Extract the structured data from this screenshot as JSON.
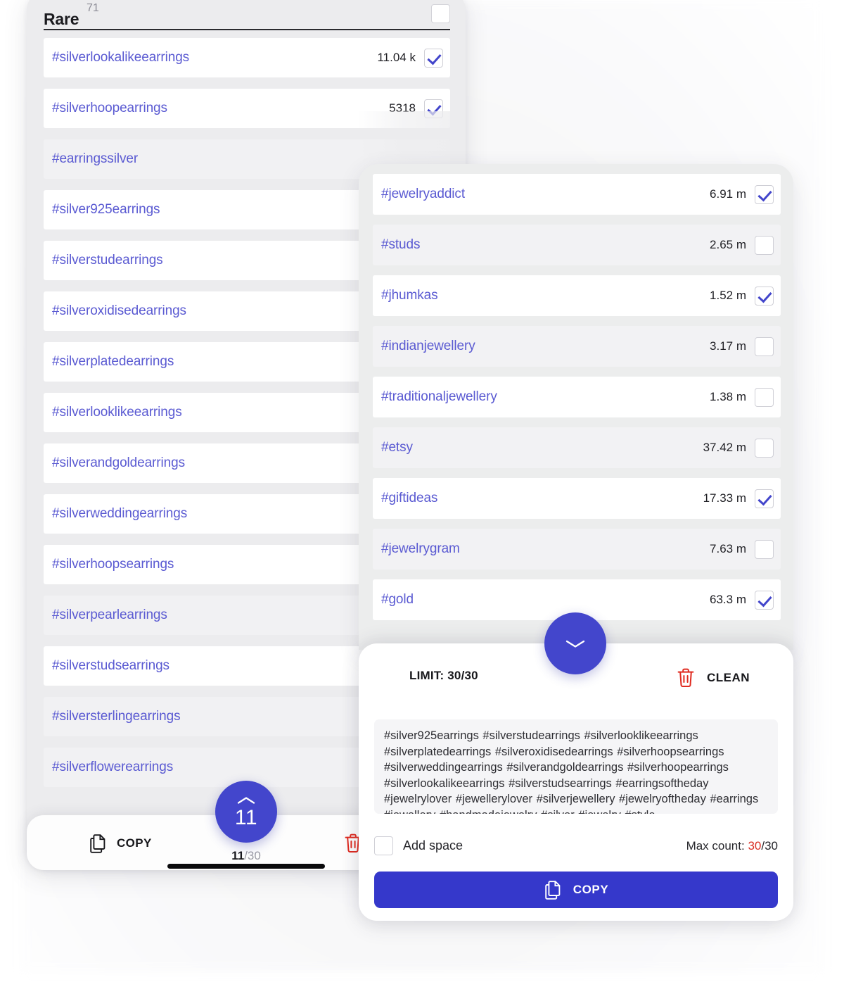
{
  "colors": {
    "accent": "#4346CC",
    "copy_button": "#3538CB",
    "tag_text": "#5A5AD2",
    "danger": "#D93025",
    "panel_bg": "#ECECEE",
    "row_white": "#FFFFFF",
    "row_grey": "#F1F1F3"
  },
  "left_panel": {
    "title": "Rare",
    "title_count": "71",
    "header_checkbox_checked": false,
    "rows": [
      {
        "tag": "#silverlookalikeearrings",
        "count": "11.04 k",
        "checked": true,
        "has_count": true,
        "style": "white"
      },
      {
        "tag": "#silverhoopearrings",
        "count": "5318",
        "checked": true,
        "has_count": true,
        "style": "white"
      },
      {
        "tag": "#earringssilver",
        "count": "",
        "checked": false,
        "has_count": false,
        "style": "grey"
      },
      {
        "tag": "#silver925earrings",
        "count": "",
        "checked": false,
        "has_count": false,
        "style": "white"
      },
      {
        "tag": "#silverstudearrings",
        "count": "",
        "checked": false,
        "has_count": false,
        "style": "white"
      },
      {
        "tag": "#silveroxidisedearrings",
        "count": "",
        "checked": false,
        "has_count": false,
        "style": "white"
      },
      {
        "tag": "#silverplatedearrings",
        "count": "",
        "checked": false,
        "has_count": false,
        "style": "white"
      },
      {
        "tag": "#silverlooklikeearrings",
        "count": "",
        "checked": false,
        "has_count": false,
        "style": "white"
      },
      {
        "tag": "#silverandgoldearrings",
        "count": "",
        "checked": false,
        "has_count": false,
        "style": "white"
      },
      {
        "tag": "#silverweddingearrings",
        "count": "",
        "checked": false,
        "has_count": false,
        "style": "white"
      },
      {
        "tag": "#silverhoopsearrings",
        "count": "",
        "checked": false,
        "has_count": false,
        "style": "white"
      },
      {
        "tag": "#silverpearlearrings",
        "count": "",
        "checked": false,
        "has_count": false,
        "style": "grey"
      },
      {
        "tag": "#silverstudsearrings",
        "count": "",
        "checked": false,
        "has_count": false,
        "style": "white"
      },
      {
        "tag": "#silversterlingearrings",
        "count": "",
        "checked": false,
        "has_count": false,
        "style": "grey"
      },
      {
        "tag": "#silverflowerearrings",
        "count": "",
        "checked": false,
        "has_count": false,
        "style": "grey"
      }
    ],
    "bottom_bar": {
      "copy_label": "COPY",
      "copy_icon": "copy-icon",
      "delete_icon": "trash-icon",
      "counter_num": "11",
      "counter_den": "/30"
    },
    "fab": {
      "icon": "chevron-up-icon",
      "value": "11"
    }
  },
  "right_panel": {
    "rows": [
      {
        "tag": "#jewelryaddict",
        "count": "6.91 m",
        "checked": true,
        "style": "white"
      },
      {
        "tag": "#studs",
        "count": "2.65 m",
        "checked": false,
        "style": "grey"
      },
      {
        "tag": "#jhumkas",
        "count": "1.52 m",
        "checked": true,
        "style": "white"
      },
      {
        "tag": "#indianjewellery",
        "count": "3.17 m",
        "checked": false,
        "style": "grey"
      },
      {
        "tag": "#traditionaljewellery",
        "count": "1.38 m",
        "checked": false,
        "style": "white"
      },
      {
        "tag": "#etsy",
        "count": "37.42 m",
        "checked": false,
        "style": "grey"
      },
      {
        "tag": "#giftideas",
        "count": "17.33 m",
        "checked": true,
        "style": "white"
      },
      {
        "tag": "#jewelrygram",
        "count": "7.63 m",
        "checked": false,
        "style": "grey"
      },
      {
        "tag": "#gold",
        "count": "63.3 m",
        "checked": true,
        "style": "white"
      }
    ],
    "fab": {
      "icon": "chevron-down-icon"
    }
  },
  "sheet": {
    "limit_label": "LIMIT: 30/30",
    "clean_label": "CLEAN",
    "clean_icon": "trash-icon",
    "tags_text": "#silver925earrings #silverstudearrings #silverlooklikeearrings #silverplatedearrings #silveroxidisedearrings #silverhoopsearrings #silverweddingearrings #silverandgoldearrings #silverhoopearrings #silverlookalikeearrings #silverstudsearrings #earringsoftheday #jewelrylover #jewellerylover #silverjewellery #jewelryoftheday #earrings #jewellery #handmadejewelry #silver #jewelry #style",
    "add_space_label": "Add space",
    "add_space_checked": false,
    "max_count_label": "Max count: ",
    "max_count_value": "30",
    "max_count_total": "/30",
    "copy_label": "COPY",
    "copy_icon": "copy-icon"
  }
}
